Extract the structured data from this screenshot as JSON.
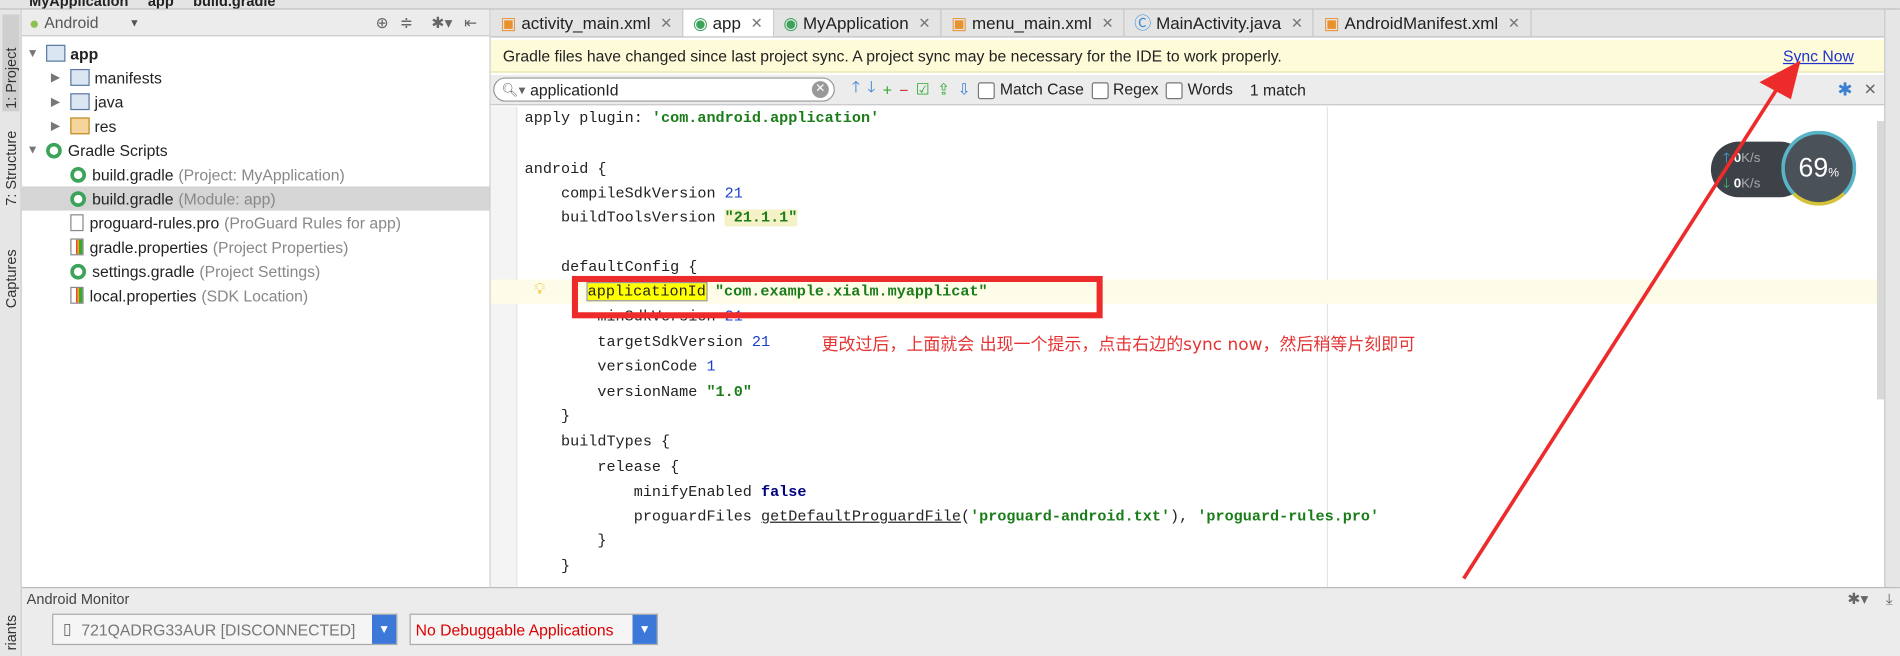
{
  "breadcrumb": [
    "MyApplication",
    "app",
    "build.gradle"
  ],
  "tool_strip": {
    "project": "1: Project",
    "structure": "7: Structure",
    "captures": "Captures",
    "variants": "riants"
  },
  "project_panel": {
    "view_selector": "Android",
    "tree": [
      {
        "label": "app",
        "hint": "",
        "icon": "module-folder-icon",
        "level": 0,
        "expanded": true
      },
      {
        "label": "manifests",
        "hint": "",
        "icon": "folder-icon",
        "level": 1,
        "expanded": false
      },
      {
        "label": "java",
        "hint": "",
        "icon": "folder-icon",
        "level": 1,
        "expanded": false
      },
      {
        "label": "res",
        "hint": "",
        "icon": "res-folder-icon",
        "level": 1,
        "expanded": false
      },
      {
        "label": "Gradle Scripts",
        "hint": "",
        "icon": "gradle-icon",
        "level": 0,
        "expanded": true
      },
      {
        "label": "build.gradle",
        "hint": "(Project: MyApplication)",
        "icon": "gradle-icon",
        "level": 1
      },
      {
        "label": "build.gradle",
        "hint": "(Module: app)",
        "icon": "gradle-icon",
        "level": 1,
        "selected": true
      },
      {
        "label": "proguard-rules.pro",
        "hint": "(ProGuard Rules for app)",
        "icon": "file-icon",
        "level": 1
      },
      {
        "label": "gradle.properties",
        "hint": "(Project Properties)",
        "icon": "properties-icon",
        "level": 1
      },
      {
        "label": "settings.gradle",
        "hint": "(Project Settings)",
        "icon": "gradle-icon",
        "level": 1
      },
      {
        "label": "local.properties",
        "hint": "(SDK Location)",
        "icon": "properties-icon",
        "level": 1
      }
    ]
  },
  "tabs": [
    {
      "label": "activity_main.xml",
      "icon": "xml-icon"
    },
    {
      "label": "app",
      "icon": "gradle-icon",
      "active": true
    },
    {
      "label": "MyApplication",
      "icon": "gradle-icon"
    },
    {
      "label": "menu_main.xml",
      "icon": "xml-icon"
    },
    {
      "label": "MainActivity.java",
      "icon": "class-icon"
    },
    {
      "label": "AndroidManifest.xml",
      "icon": "xml-icon"
    }
  ],
  "banner": {
    "message": "Gradle files have changed since last project sync. A project sync may be necessary for the IDE to work properly.",
    "action": "Sync Now"
  },
  "search": {
    "query": "applicationId",
    "match_case": "Match Case",
    "regex": "Regex",
    "words": "Words",
    "result": "1 match"
  },
  "code": {
    "l1a": "apply plugin: ",
    "l1b": "'com.android.application'",
    "l3": "android {",
    "l4a": "    compileSdkVersion ",
    "l4b": "21",
    "l5a": "    buildToolsVersion ",
    "l5b": "\"21.1.1\"",
    "l7": "    defaultConfig {",
    "l8a": "applicationId",
    "l8b": " \"com.example.xialm.myapplicat\"",
    "l9a": "        minSdkVersion ",
    "l9b": "21",
    "l10a": "        targetSdkVersion ",
    "l10b": "21",
    "l11a": "        versionCode ",
    "l11b": "1",
    "l12a": "        versionName ",
    "l12b": "\"1.0\"",
    "l13": "    }",
    "l14": "    buildTypes {",
    "l15": "        release {",
    "l16a": "            minifyEnabled ",
    "l16b": "false",
    "l17a": "            proguardFiles ",
    "l17b": "getDefaultProguardFile",
    "l17c": "(",
    "l17d": "'proguard-android.txt'",
    "l17e": "), ",
    "l17f": "'proguard-rules.pro'",
    "l18": "        }",
    "l19": "    }"
  },
  "annotation": {
    "text": "更改过后，上面就会 出现一个提示，点击右边的sync now，然后稍等片刻即可",
    "color": "#e53333"
  },
  "network_widget": {
    "upload": "0",
    "download": "0",
    "unit": "K/s",
    "percent": "69",
    "percent_unit": "%"
  },
  "android_monitor": {
    "title": "Android Monitor",
    "device": "721QADRG33AUR [DISCONNECTED]",
    "app": "No Debuggable Applications"
  }
}
